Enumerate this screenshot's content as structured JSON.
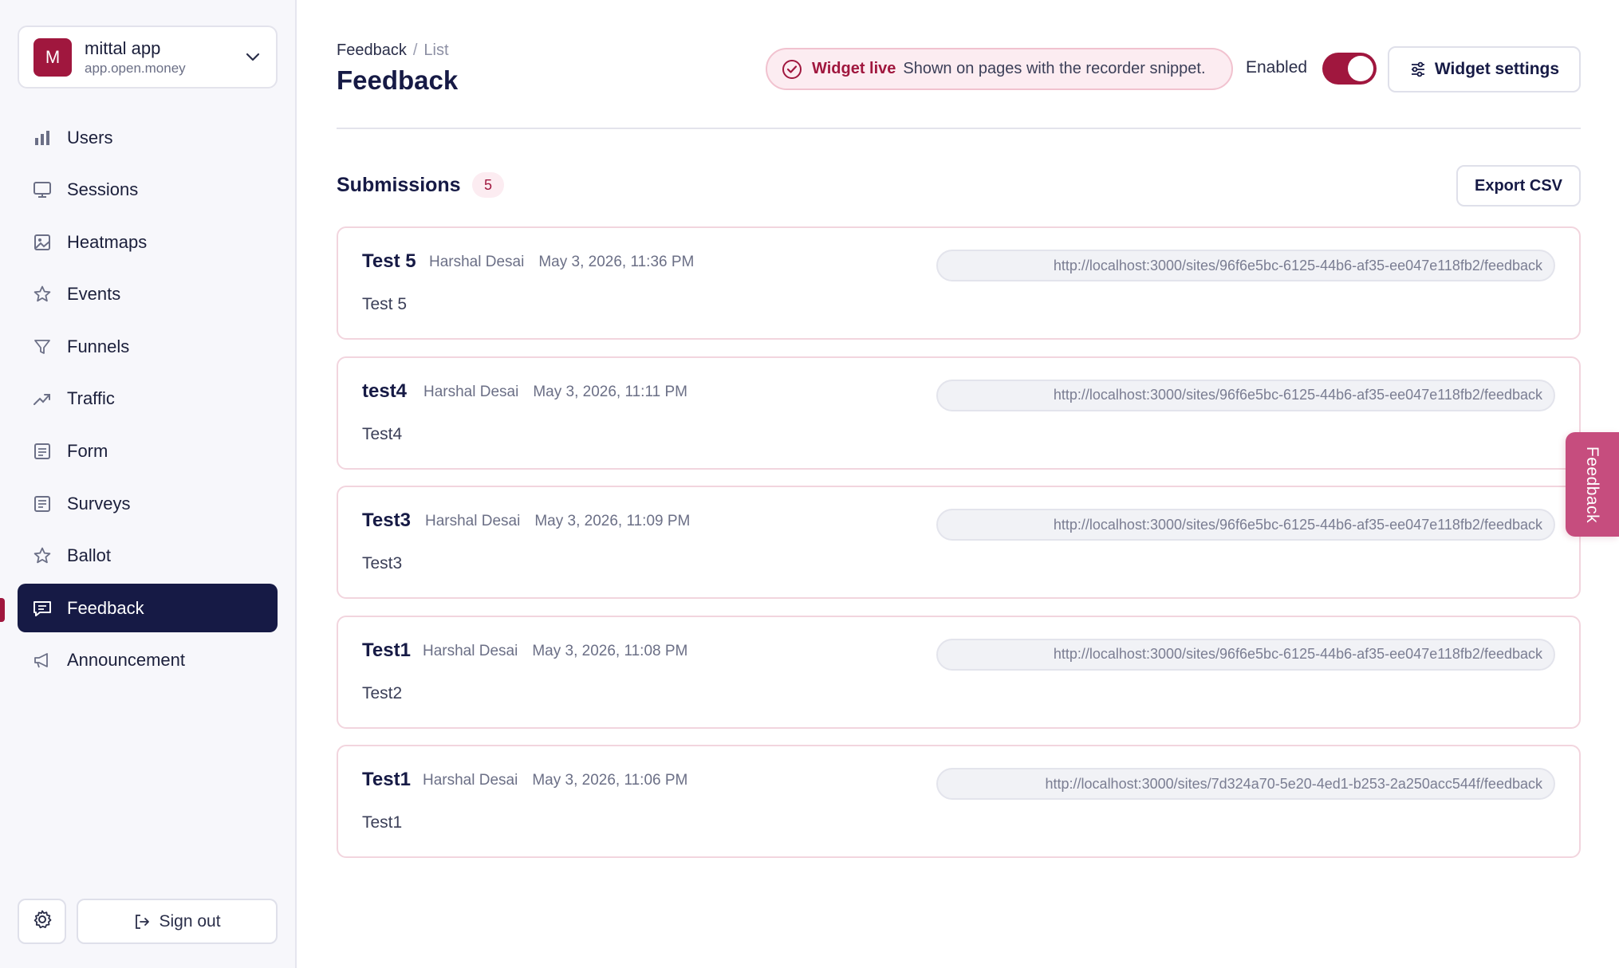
{
  "workspace": {
    "initial": "M",
    "name": "mittal app",
    "domain": "app.open.money"
  },
  "sidebar": {
    "items": [
      {
        "label": "Users",
        "icon": "bar-chart-icon"
      },
      {
        "label": "Sessions",
        "icon": "monitor-icon"
      },
      {
        "label": "Heatmaps",
        "icon": "image-icon"
      },
      {
        "label": "Events",
        "icon": "star-icon"
      },
      {
        "label": "Funnels",
        "icon": "funnel-icon"
      },
      {
        "label": "Traffic",
        "icon": "trending-up-icon"
      },
      {
        "label": "Form",
        "icon": "form-icon"
      },
      {
        "label": "Surveys",
        "icon": "survey-icon"
      },
      {
        "label": "Ballot",
        "icon": "star-icon"
      },
      {
        "label": "Feedback",
        "icon": "message-square-icon",
        "active": true
      },
      {
        "label": "Announcement",
        "icon": "megaphone-icon"
      }
    ],
    "sign_out_label": "Sign out"
  },
  "header": {
    "breadcrumb_root": "Feedback",
    "breadcrumb_sep": "/",
    "breadcrumb_current": "List",
    "title": "Feedback",
    "live_status": "Widget live",
    "live_desc": "Shown on pages with the recorder snippet.",
    "enabled_label": "Enabled",
    "enabled": true,
    "widget_settings_label": "Widget settings"
  },
  "submissions": {
    "title": "Submissions",
    "count": "5",
    "export_label": "Export CSV",
    "items": [
      {
        "title": "Test 5",
        "author": "Harshal Desai",
        "date": "May 3, 2026, 11:36 PM",
        "url": "http://localhost:3000/sites/96f6e5bc-6125-44b6-af35-ee047e118fb2/feedback",
        "body": "Test 5"
      },
      {
        "title": "test4",
        "author": "Harshal Desai",
        "date": "May 3, 2026, 11:11 PM",
        "url": "http://localhost:3000/sites/96f6e5bc-6125-44b6-af35-ee047e118fb2/feedback",
        "body": "Test4"
      },
      {
        "title": "Test3",
        "author": "Harshal Desai",
        "date": "May 3, 2026, 11:09 PM",
        "url": "http://localhost:3000/sites/96f6e5bc-6125-44b6-af35-ee047e118fb2/feedback",
        "body": "Test3"
      },
      {
        "title": "Test1",
        "author": "Harshal Desai",
        "date": "May 3, 2026, 11:08 PM",
        "url": "http://localhost:3000/sites/96f6e5bc-6125-44b6-af35-ee047e118fb2/feedback",
        "body": "Test2"
      },
      {
        "title": "Test1",
        "author": "Harshal Desai",
        "date": "May 3, 2026, 11:06 PM",
        "url": "http://localhost:3000/sites/7d324a70-5e20-4ed1-b253-2a250acc544f/feedback",
        "body": "Test1"
      }
    ]
  },
  "feedback_tab": {
    "label": "Feedback"
  },
  "colors": {
    "accent": "#a0173e",
    "nav_active": "#161a45",
    "tab": "#c64d7e"
  }
}
